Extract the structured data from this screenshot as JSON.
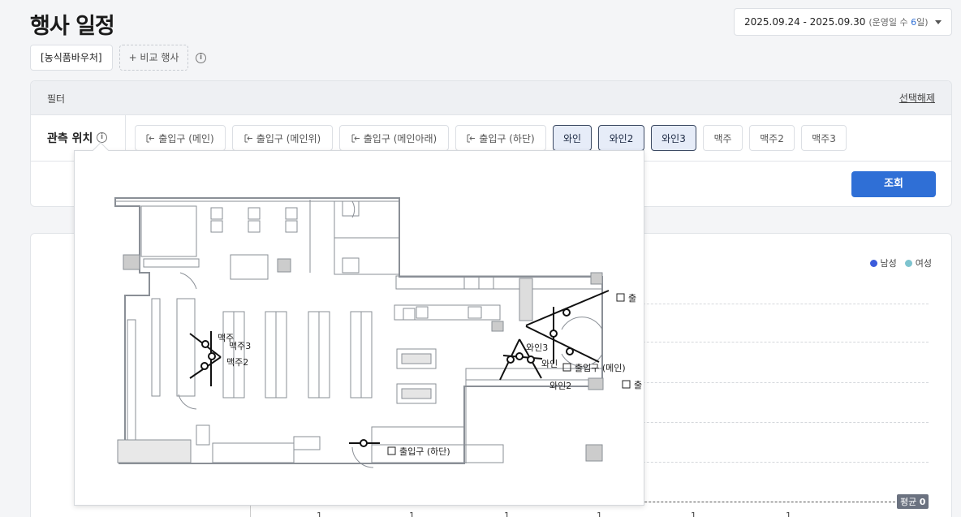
{
  "header": {
    "title": "행사 일정",
    "date_range": "2025.09.24 - 2025.09.30",
    "operating_days_prefix": "(운영일 수 ",
    "operating_days_num": "6",
    "operating_days_suffix": "일)"
  },
  "event": {
    "selected": "[농식품바우처]",
    "compare_label": "+ 비교 행사"
  },
  "filter": {
    "title": "필터",
    "clear_label": "선택해제",
    "location_label": "관측 위치",
    "locations": [
      {
        "label": "출입구 (메인)",
        "door": true,
        "selected": false
      },
      {
        "label": "출입구 (메인위)",
        "door": true,
        "selected": false
      },
      {
        "label": "출입구 (메인아래)",
        "door": true,
        "selected": false
      },
      {
        "label": "출입구 (하단)",
        "door": true,
        "selected": false
      },
      {
        "label": "와인",
        "door": false,
        "selected": true
      },
      {
        "label": "와인2",
        "door": false,
        "selected": true
      },
      {
        "label": "와인3",
        "door": false,
        "selected": true
      },
      {
        "label": "맥주",
        "door": false,
        "selected": false
      },
      {
        "label": "맥주2",
        "door": false,
        "selected": false
      },
      {
        "label": "맥주3",
        "door": false,
        "selected": false
      }
    ],
    "query_label": "조회"
  },
  "chart": {
    "legend": [
      {
        "name": "남성",
        "color": "#3b5bdb"
      },
      {
        "name": "여성",
        "color": "#7ec4cf"
      }
    ],
    "avg_label": "평균",
    "avg_value": "0",
    "ticks": [
      "1",
      "1",
      "1",
      "1",
      "1",
      "1"
    ]
  },
  "map": {
    "labels": {
      "beer1": "맥주",
      "beer3": "맥주3",
      "beer2": "맥주2",
      "wine3": "와인3",
      "wine1": "와인",
      "wine2": "와인2",
      "entrance_main": "출입구 (메인)",
      "entrance_bottom": "출입구 (하단)",
      "cut_top": "출",
      "cut_mid": "출"
    }
  }
}
